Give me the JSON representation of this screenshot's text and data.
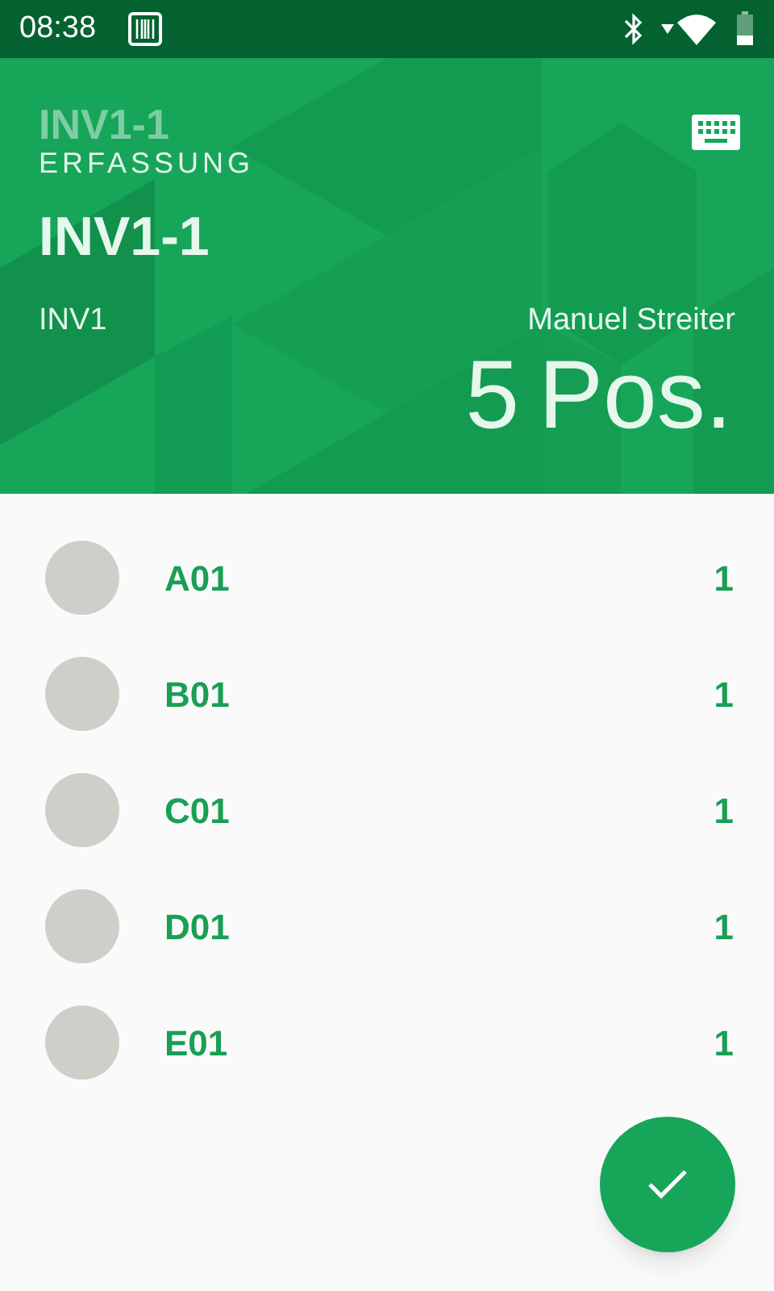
{
  "status_bar": {
    "time": "08:38"
  },
  "header": {
    "faded_title": "INV1-1",
    "subtitle": "ERFASSUNG",
    "title": "INV1-1",
    "inventory": "INV1",
    "user": "Manuel Streiter",
    "count": "5",
    "count_unit": "Pos."
  },
  "items": [
    {
      "label": "A01",
      "quantity": "1"
    },
    {
      "label": "B01",
      "quantity": "1"
    },
    {
      "label": "C01",
      "quantity": "1"
    },
    {
      "label": "D01",
      "quantity": "1"
    },
    {
      "label": "E01",
      "quantity": "1"
    }
  ]
}
